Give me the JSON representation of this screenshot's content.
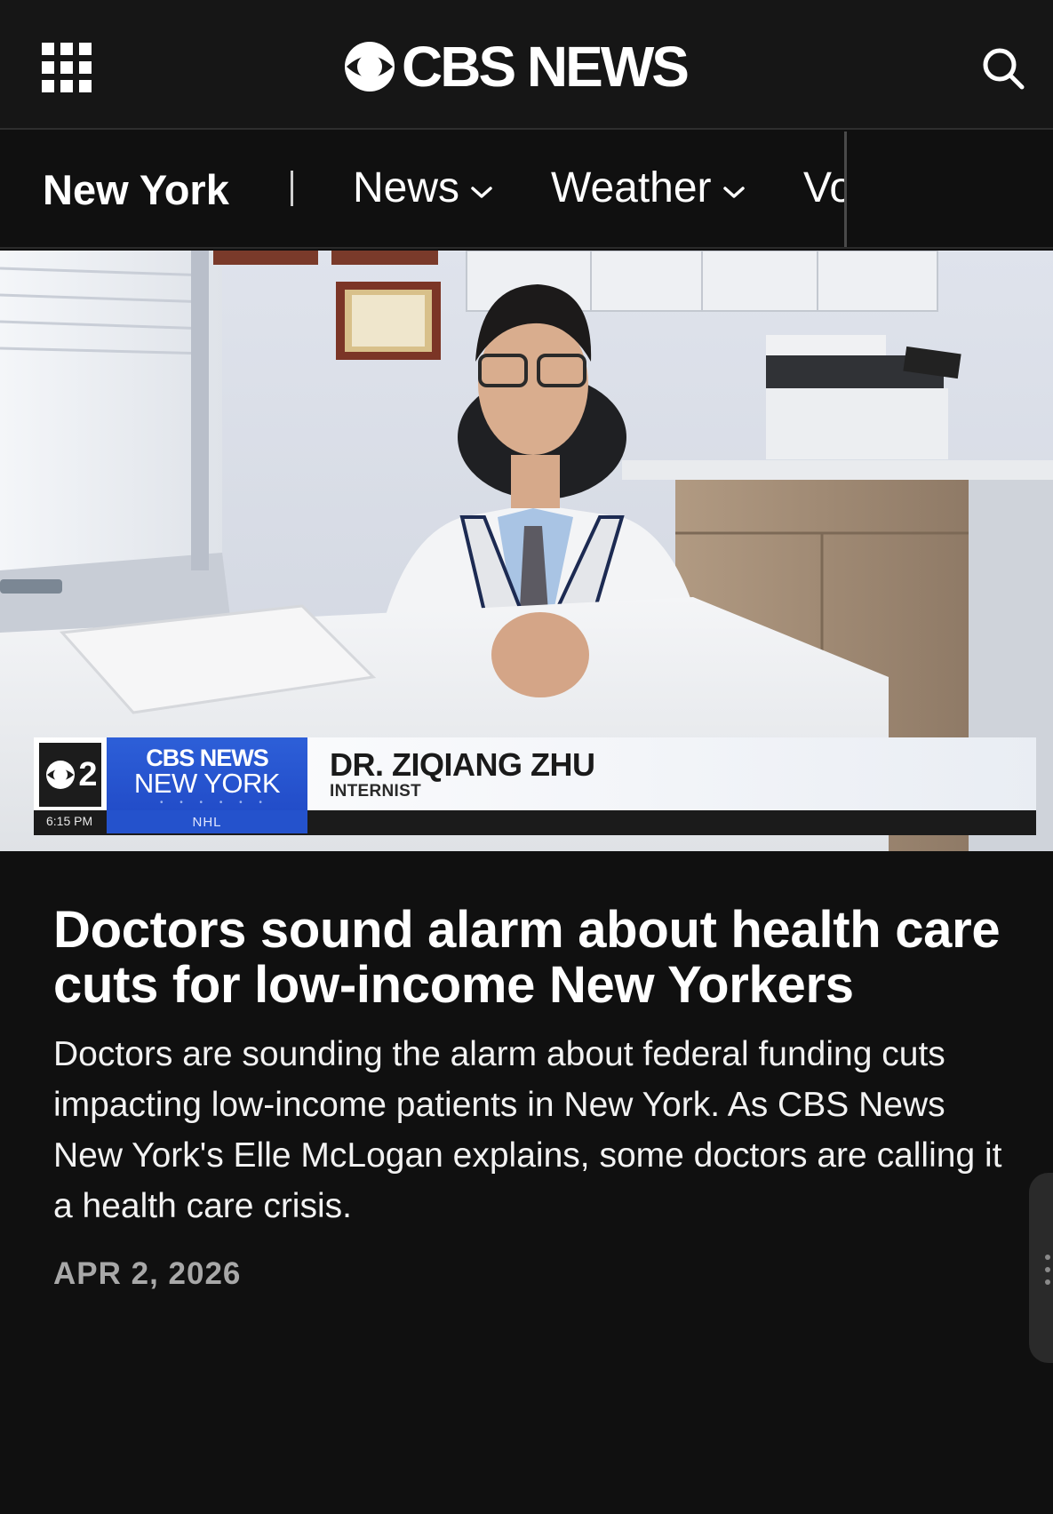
{
  "header": {
    "logo_text": "CBS NEWS",
    "menu_icon": "grid-menu-icon",
    "search_icon": "search-icon"
  },
  "nav": {
    "region": "New York",
    "items": [
      {
        "label": "News",
        "has_dropdown": true
      },
      {
        "label": "Weather",
        "has_dropdown": true
      },
      {
        "label": "Vo",
        "has_dropdown": false
      }
    ]
  },
  "video": {
    "lower_third": {
      "channel": "2",
      "network": "CBS NEWS",
      "station": "NEW YORK",
      "name": "DR. ZIQIANG ZHU",
      "title": "INTERNIST",
      "time": "6:15 PM",
      "ticker": "NHL"
    }
  },
  "article": {
    "headline": "Doctors sound alarm about health care cuts for low-income New Yorkers",
    "summary": "Doctors are sounding the alarm about federal funding cuts impacting low-income patients in New York. As CBS News New York's Elle McLogan explains, some doctors are calling it a health care crisis.",
    "date": "APR 2, 2026"
  },
  "colors": {
    "background": "#101010",
    "header_bg": "#161616",
    "accent_blue": "#2452cc",
    "date_gray": "#a8a8a8"
  }
}
